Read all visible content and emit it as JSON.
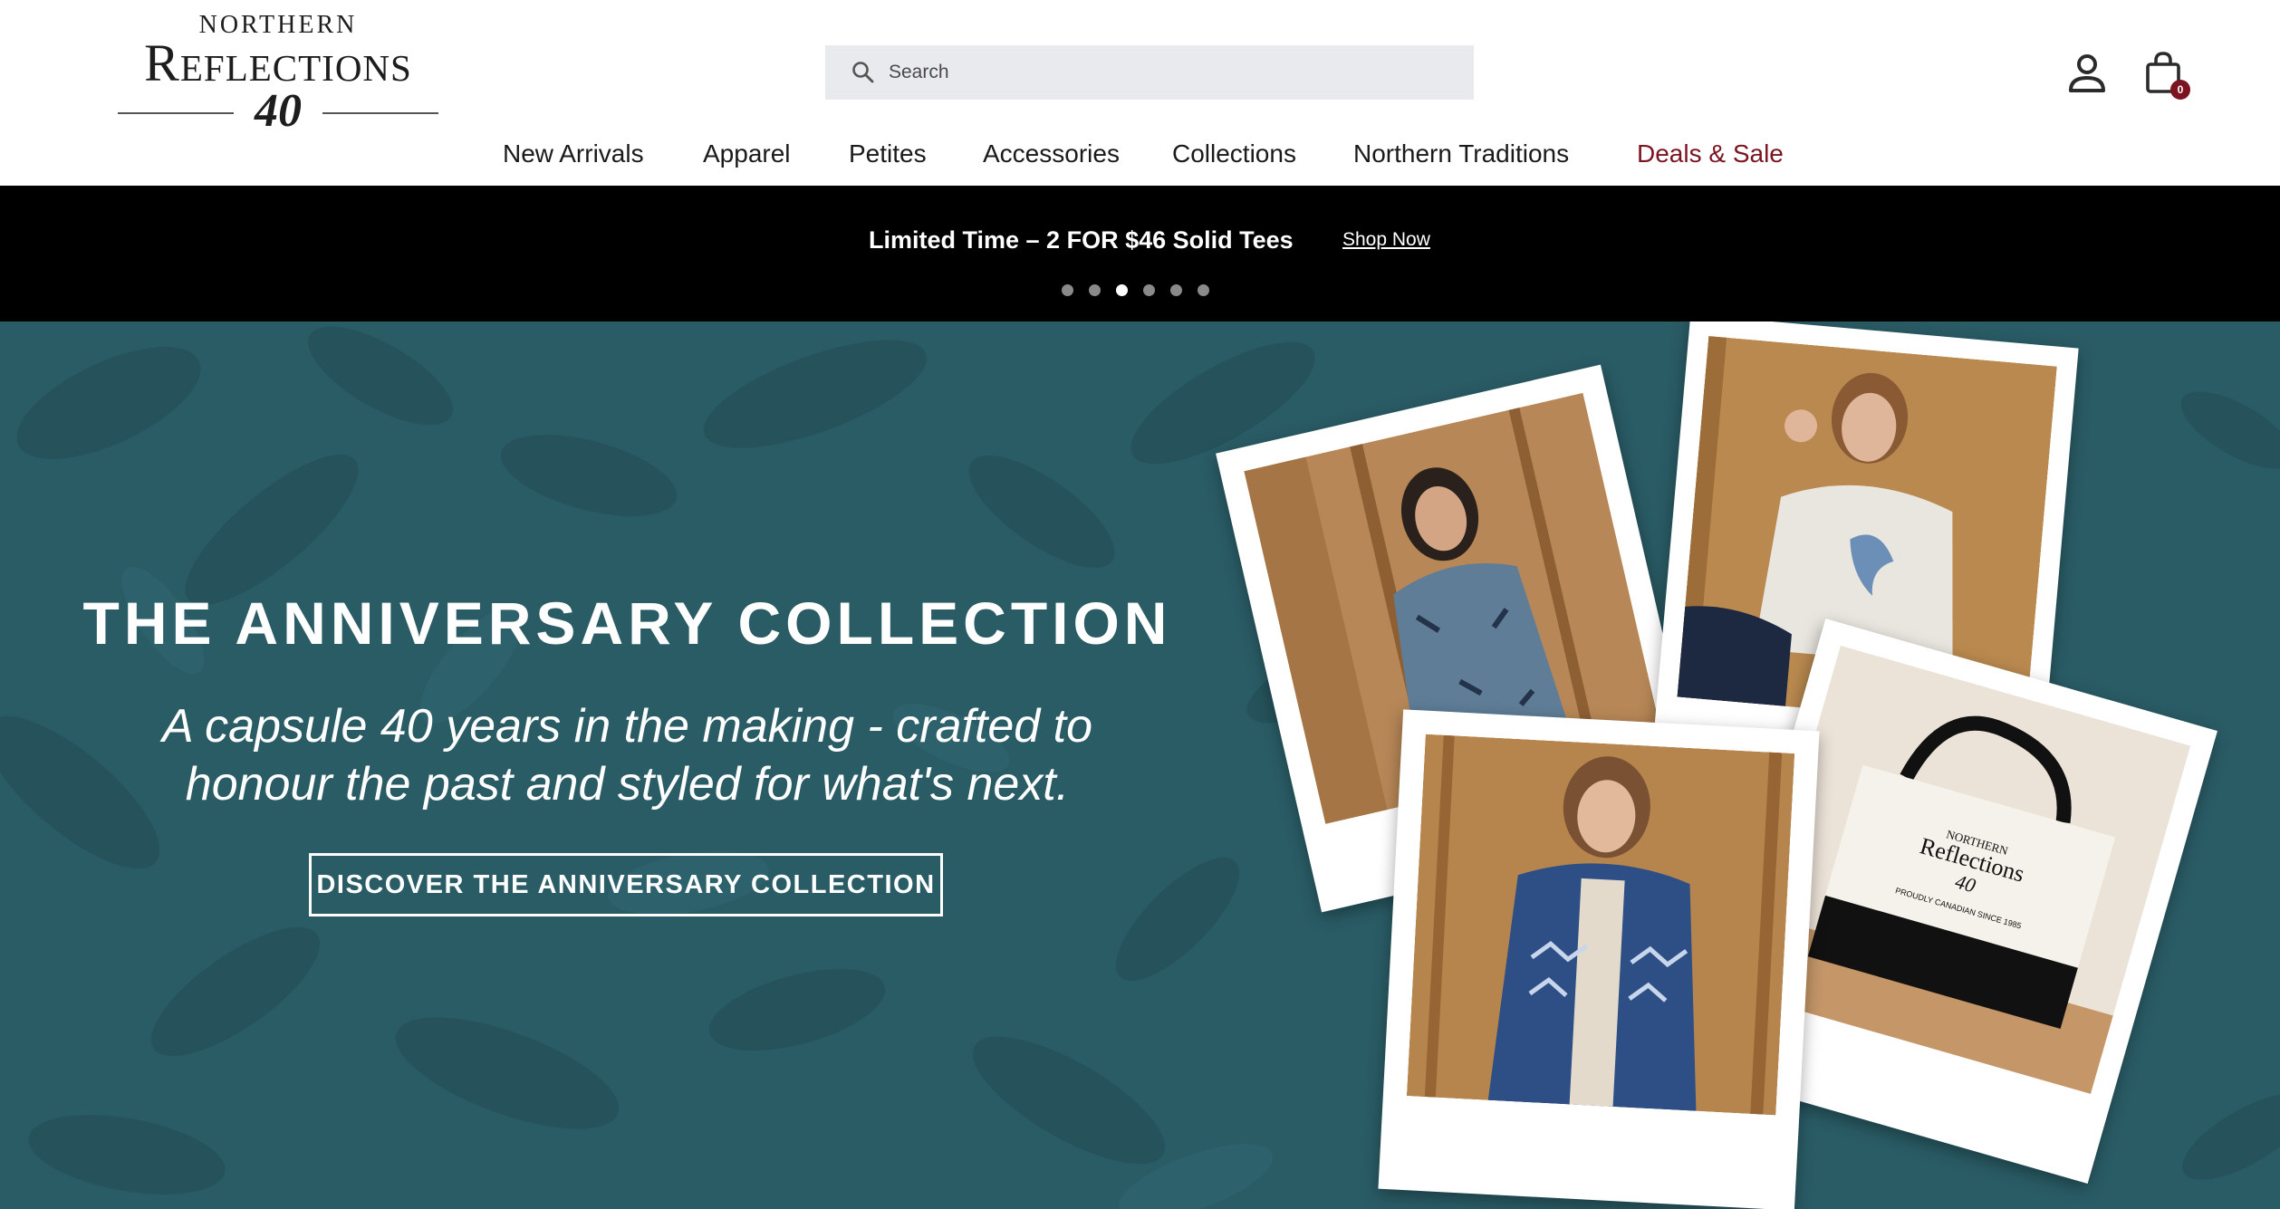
{
  "brand": {
    "logo_top": "NORTHERN",
    "logo_main": "Reflections",
    "logo_number": "40"
  },
  "search": {
    "placeholder": "Search"
  },
  "header_icons": {
    "account_icon": "person-icon",
    "cart_icon": "shopping-bag-icon",
    "cart_count": "0"
  },
  "nav": {
    "items": [
      {
        "label": "New Arrivals"
      },
      {
        "label": "Apparel"
      },
      {
        "label": "Petites"
      },
      {
        "label": "Accessories"
      },
      {
        "label": "Collections"
      },
      {
        "label": "Northern Traditions"
      },
      {
        "label": "Deals & Sale"
      }
    ],
    "sale_color": "#7b1420"
  },
  "promo": {
    "text": "Limited Time – 2 FOR $46 Solid Tees",
    "link": "Shop Now",
    "slide_count": 6,
    "active_slide": 3
  },
  "hero": {
    "title": "THE ANNIVERSARY COLLECTION",
    "subtitle_line1": "A capsule 40 years in the making - crafted to",
    "subtitle_line2": "honour the past and styled for what's next.",
    "cta": "DISCOVER THE ANNIVERSARY COLLECTION",
    "background_color": "#2a5c66",
    "tote_text_line1": "NORTHERN",
    "tote_text_line2": "Reflections",
    "tote_text_line3": "40",
    "tote_text_line4": "PROUDLY CANADIAN SINCE 1985"
  }
}
